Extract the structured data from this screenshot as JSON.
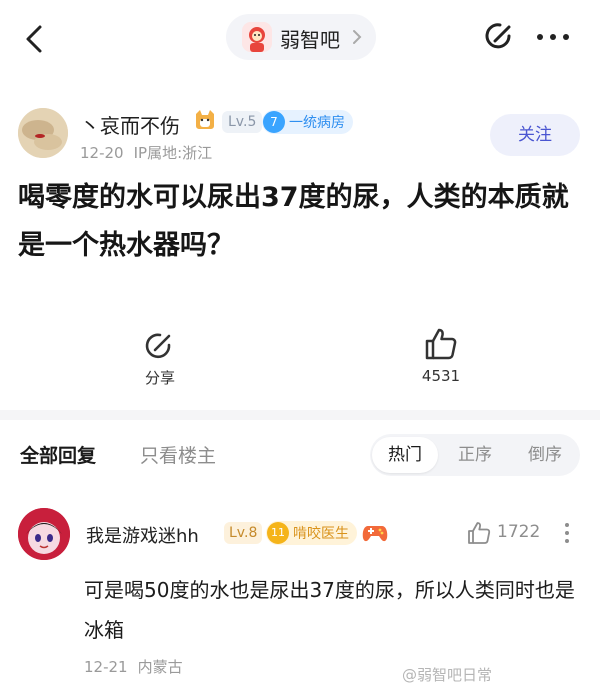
{
  "forum": {
    "name": "弱智吧"
  },
  "author": {
    "name": "丶哀而不伤",
    "level": "Lv.5",
    "honor_level": "7",
    "honor_title": "一统病房",
    "date": "12-20",
    "ip_location": "IP属地:浙江"
  },
  "follow_label": "关注",
  "post": {
    "title": "喝零度的水可以尿出37度的尿，人类的本质就是一个热水器吗？"
  },
  "actions": {
    "share_label": "分享",
    "like_count": "4531"
  },
  "replies_header": {
    "all_label": "全部回复",
    "op_only_label": "只看楼主",
    "sort_options": [
      "热门",
      "正序",
      "倒序"
    ],
    "active_sort": "热门"
  },
  "reply": {
    "user": "我是游戏迷hh",
    "level": "Lv.8",
    "honor_level": "11",
    "honor_title": "啃咬医生",
    "like_count": "1722",
    "text": "可是喝50度的水也是尿出37度的尿，所以人类同时也是冰箱",
    "date": "12-21",
    "location": "内蒙古"
  },
  "watermark": "@弱智吧日常",
  "colors": {
    "accent": "#4a55d1",
    "follow_bg": "#eef0fb",
    "honor_blue": "#3aa4ff",
    "honor_gold": "#f5b41a",
    "divider": "#f5f5f7"
  }
}
